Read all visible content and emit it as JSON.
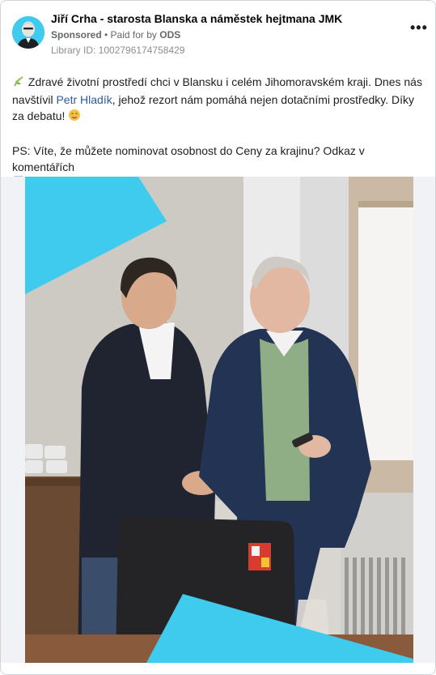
{
  "post": {
    "page_name": "Jiří Crha - starosta Blanska a náměstek hejtmana JMK",
    "sponsored_label": "Sponsored",
    "separator": " • ",
    "paid_for_prefix": "Paid for by ",
    "paid_for_by": "ODS",
    "library_id": "Library ID: 1002796174758429",
    "more_icon": "more-horizontal-icon"
  },
  "body_text": {
    "line1_emoji": "herb-icon",
    "line1_pre_link": " Zdravé životní prostředí chci v Blansku i celém Jihomoravském kraji. Dnes nás navštívil ",
    "mention": "Petr Hladík",
    "line1_post_link": ", jehož rezort nám pomáhá nejen dotačními prostředky. Díky za debatu! ",
    "end_emoji": "smiling-face-icon",
    "ps_text": "PS: Víte, že můžete nominovat osobnost do Ceny za krajinu? Odkaz v komentářích ",
    "ps_emoji": "arrow-down-right-icon"
  },
  "colors": {
    "accent_cyan": "#3fcbee",
    "link": "#2e5a9c",
    "secondary_text": "#65676b"
  }
}
